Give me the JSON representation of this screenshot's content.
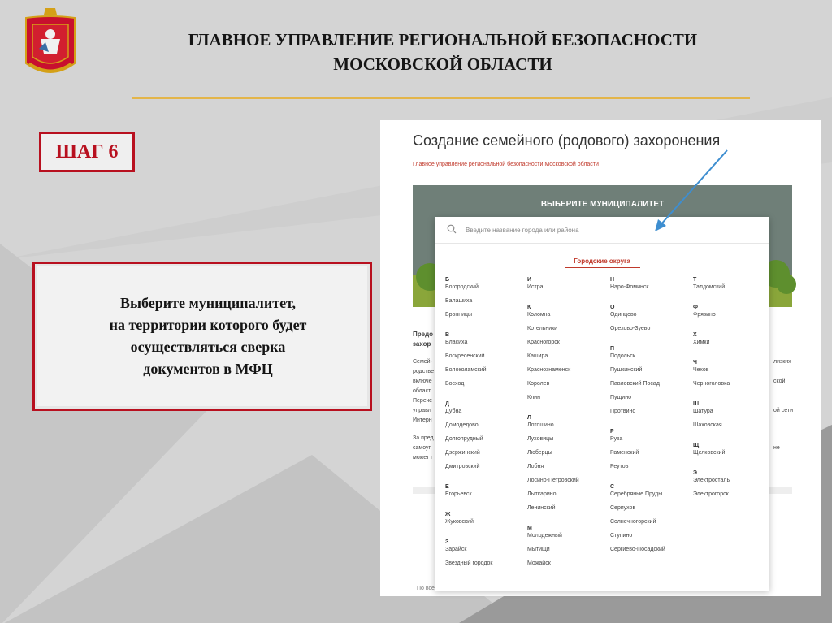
{
  "header": {
    "title_line1": "ГЛАВНОЕ УПРАВЛЕНИЕ РЕГИОНАЛЬНОЙ БЕЗОПАСНОСТИ",
    "title_line2": "МОСКОВСКОЙ ОБЛАСТИ"
  },
  "step": {
    "label": "ШАГ 6"
  },
  "instruction": {
    "line1": "Выберите муниципалитет,",
    "line2": "на территории которого будет",
    "line3": "осуществляться сверка",
    "line4": "документов в МФЦ"
  },
  "screenshot": {
    "title": "Создание семейного (родового) захоронения",
    "subtitle": "Главное управление региональной безопасности Московской области",
    "hero_title": "ВЫБЕРИТЕ МУНИЦИПАЛИТЕТ",
    "left_fragments": [
      "Предо",
      "захор",
      "Семей-",
      "родстве",
      "включе",
      "област",
      "Перече",
      "управл",
      "Интерн",
      "За пред",
      "самоуп",
      "может г"
    ],
    "right_fragments": [
      "лизких",
      "ской",
      "ой сети",
      "не"
    ],
    "footer_note": "По всем"
  },
  "search": {
    "placeholder": "Введите название города или района"
  },
  "section": {
    "label": "Городские округа"
  },
  "columns": [
    [
      {
        "letter": "Б",
        "cities": [
          "Богородский",
          "Балашиха",
          "Бронницы"
        ]
      },
      {
        "letter": "В",
        "cities": [
          "Власиха",
          "Воскресенский",
          "Волоколамский",
          "Восход"
        ]
      },
      {
        "letter": "Д",
        "cities": [
          "Дубна",
          "Домодедово",
          "Долгопрудный",
          "Дзержинский",
          "Дмитровский"
        ]
      },
      {
        "letter": "Е",
        "cities": [
          "Егорьевск"
        ]
      },
      {
        "letter": "Ж",
        "cities": [
          "Жуковский"
        ]
      },
      {
        "letter": "З",
        "cities": [
          "Зарайск",
          "Звездный городок"
        ]
      }
    ],
    [
      {
        "letter": "И",
        "cities": [
          "Истра"
        ]
      },
      {
        "letter": "К",
        "cities": [
          "Коломна",
          "Котельники",
          "Красногорск",
          "Кашира",
          "Краснознаменск",
          "Королев",
          "Клин"
        ]
      },
      {
        "letter": "Л",
        "cities": [
          "Лотошино",
          "Луховицы",
          "Люберцы",
          "Лобня",
          "Лосино-Петровский",
          "Лыткарино",
          "Ленинский"
        ]
      },
      {
        "letter": "М",
        "cities": [
          "Молодежный",
          "Мытищи",
          "Можайск"
        ]
      }
    ],
    [
      {
        "letter": "Н",
        "cities": [
          "Наро-Фоминск"
        ]
      },
      {
        "letter": "О",
        "cities": [
          "Одинцово",
          "Орехово-Зуево"
        ]
      },
      {
        "letter": "П",
        "cities": [
          "Подольск",
          "Пушкинский",
          "Павловский Посад",
          "Пущино",
          "Протвино"
        ]
      },
      {
        "letter": "Р",
        "cities": [
          "Руза",
          "Раменский",
          "Реутов"
        ]
      },
      {
        "letter": "С",
        "cities": [
          "Серебряные Пруды",
          "Серпухов",
          "Солнечногорский",
          "Ступино",
          "Сергиево-Посадский"
        ]
      }
    ],
    [
      {
        "letter": "Т",
        "cities": [
          "Талдомский"
        ]
      },
      {
        "letter": "Ф",
        "cities": [
          "Фрязино"
        ]
      },
      {
        "letter": "Х",
        "cities": [
          "Химки"
        ]
      },
      {
        "letter": "Ч",
        "cities": [
          "Чехов",
          "Черноголовка"
        ]
      },
      {
        "letter": "Ш",
        "cities": [
          "Шатура",
          "Шаховская"
        ]
      },
      {
        "letter": "Щ",
        "cities": [
          "Щелковский"
        ]
      },
      {
        "letter": "Э",
        "cities": [
          "Электросталь",
          "Электрогорск"
        ]
      }
    ]
  ],
  "colors": {
    "accent_red": "#b8101f",
    "gold_line": "#e3b54a",
    "link_red": "#c0392b"
  }
}
